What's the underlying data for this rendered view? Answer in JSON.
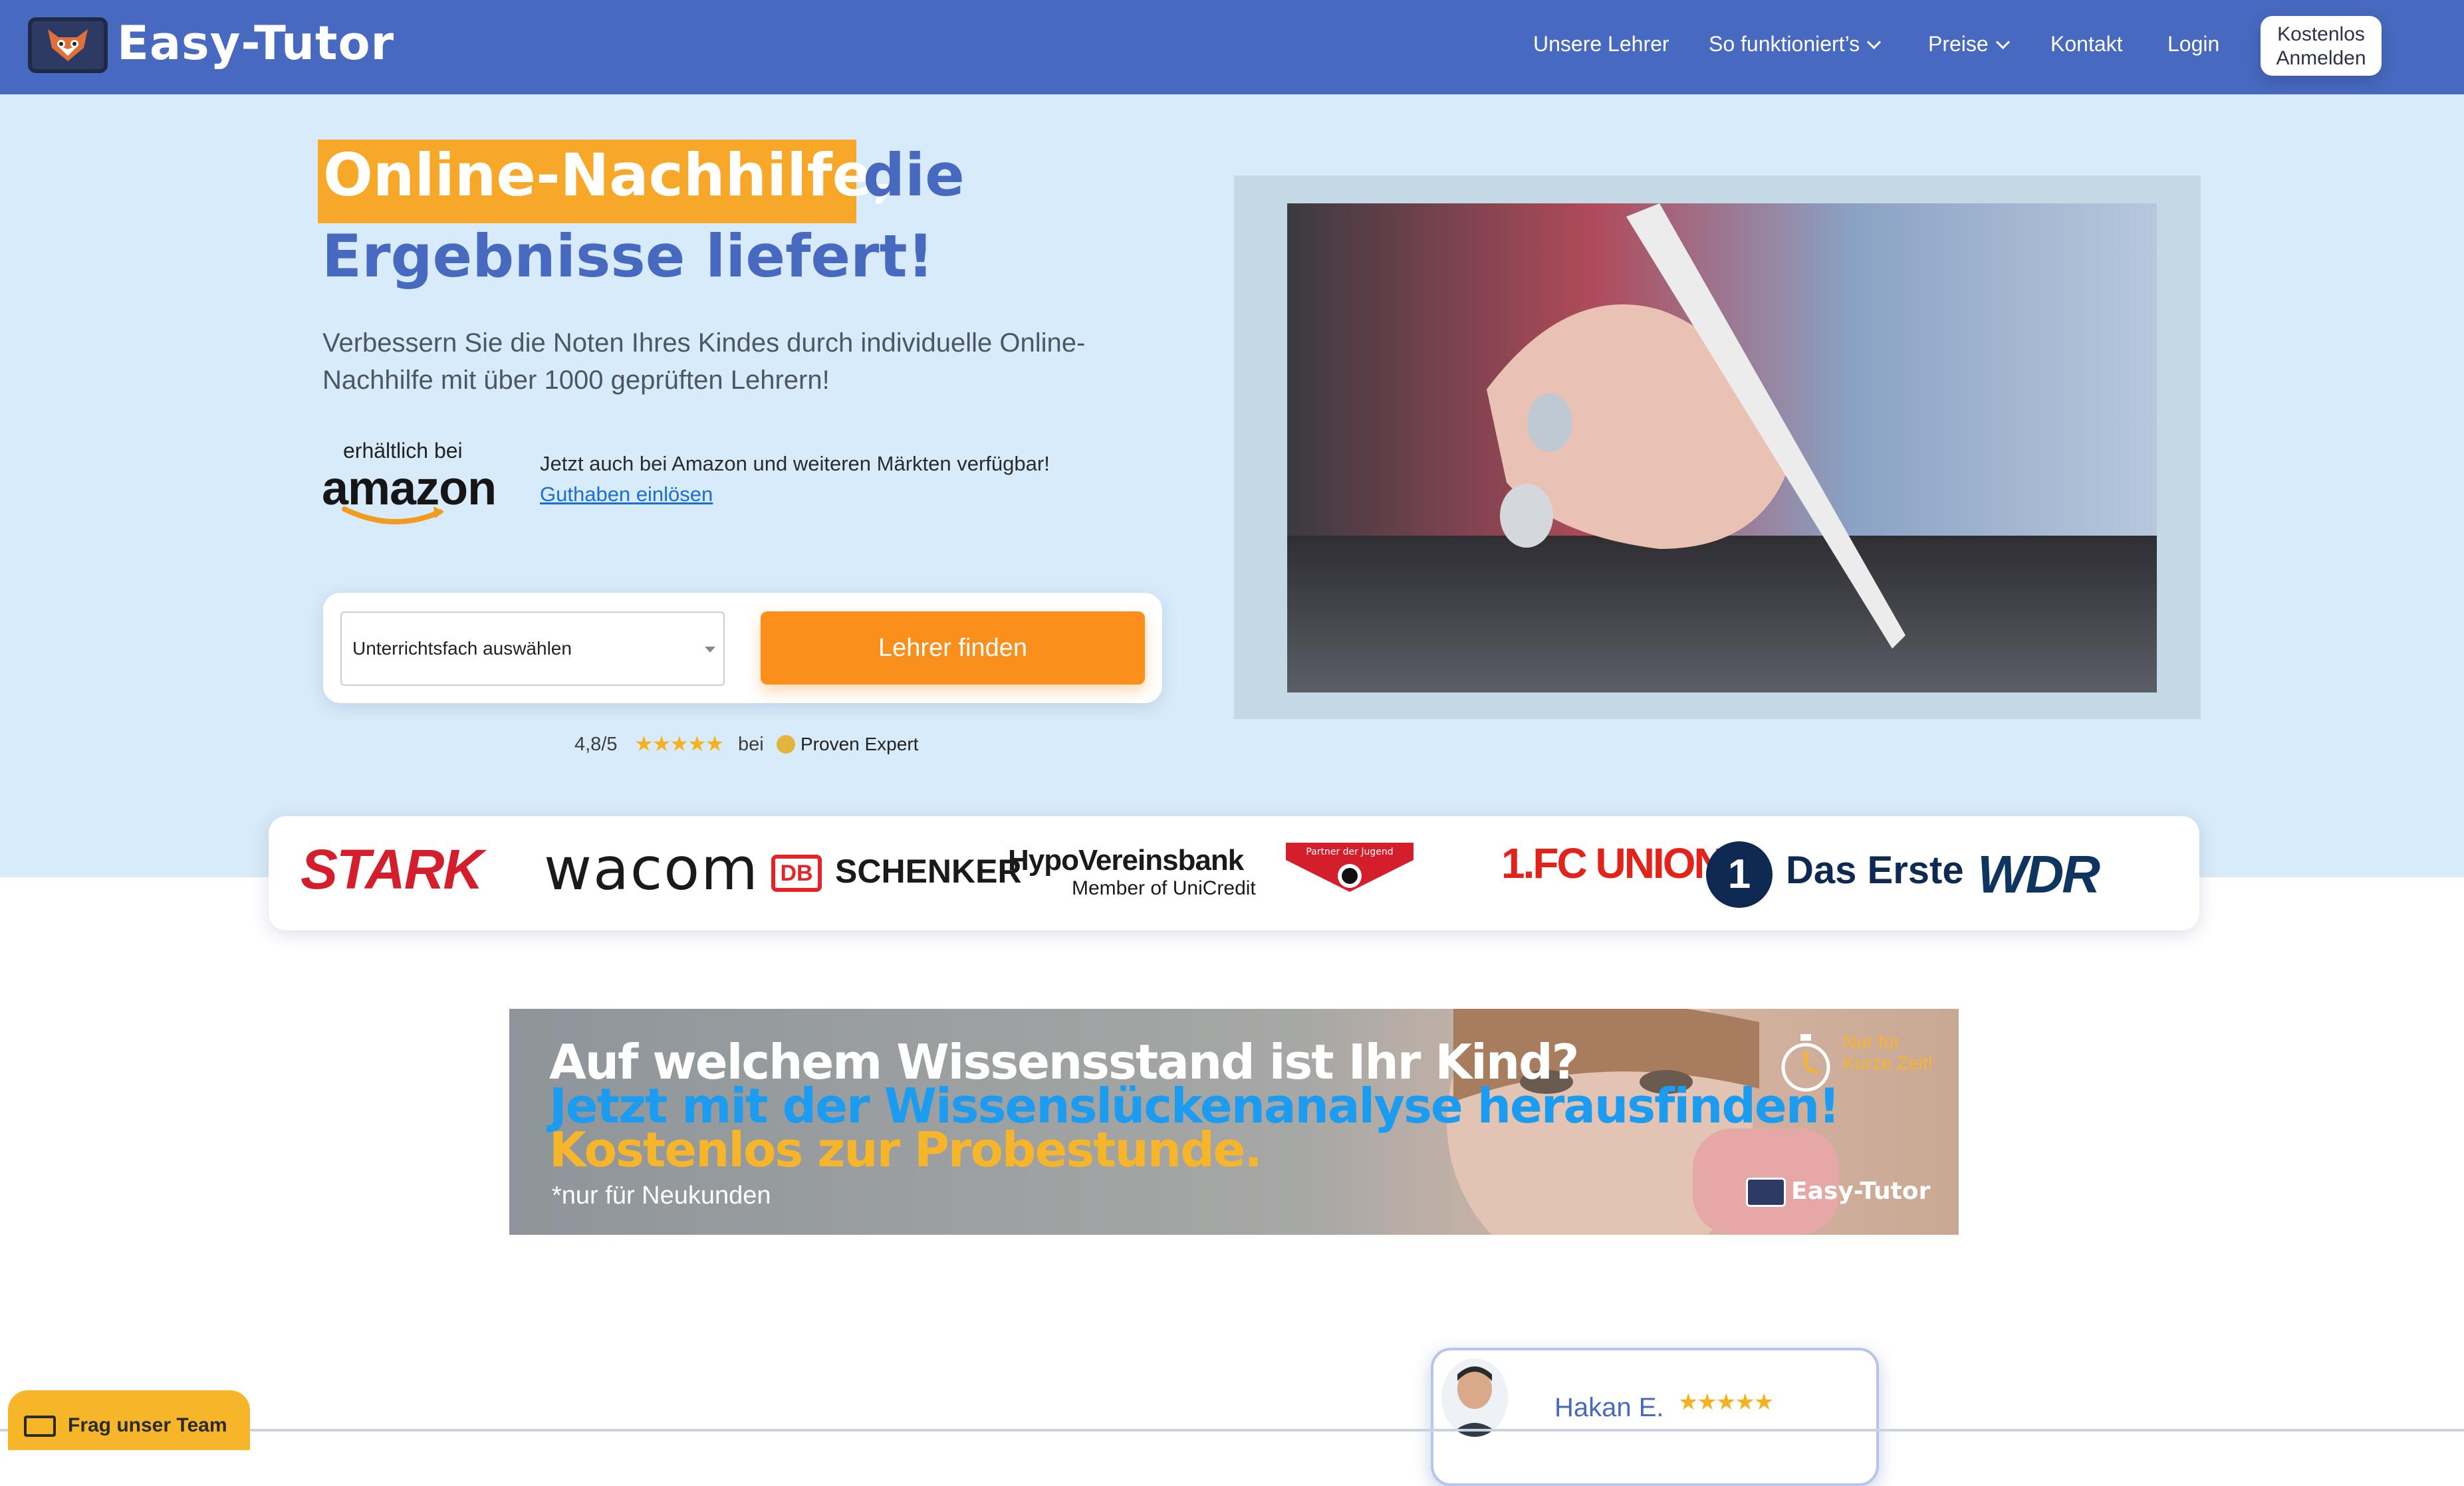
{
  "brand": {
    "name": "Easy-Tutor"
  },
  "nav": {
    "items": [
      {
        "label": "Unsere Lehrer"
      },
      {
        "label": "So funktioniert’s"
      },
      {
        "label": "Preise"
      },
      {
        "label": "Kontakt"
      },
      {
        "label": "Login"
      }
    ],
    "signup": {
      "line1": "Kostenlos",
      "line2": "Anmelden"
    }
  },
  "hero": {
    "headline_highlight": "Online-Nachhilfe,",
    "headline_rest": "die",
    "headline_line2": "Ergebnisse liefert!",
    "subtitle": "Verbessern Sie die Noten Ihres Kindes durch individuelle Online-Nachhilfe mit über 1000 geprüften Lehrern!",
    "amazon": {
      "badge_small": "erhältlich bei",
      "badge_big": "amazon",
      "text": "Jetzt auch bei Amazon und weiteren Märkten verfügbar!",
      "link": "Guthaben einlösen"
    },
    "search": {
      "select_value": "Unterrichtsfach auswählen",
      "button": "Lehrer finden"
    },
    "rating": {
      "score": "4,8/5",
      "stars": "★★★★★",
      "bei": "bei",
      "provider": "Proven Expert"
    }
  },
  "partners": {
    "stark": "STARK",
    "wacom": "wacom",
    "db": "DB",
    "schenker": "SCHENKER",
    "hypo": "HypoVereinsbank",
    "unicredit": "Member of UniCredit",
    "bayer_text": "Partner der Jugend",
    "union": "1.FC UNION",
    "erste_num": "1",
    "erste": "Das Erste",
    "wdr": "WDR"
  },
  "banner": {
    "line1": "Auf welchem Wissensstand ist Ihr Kind?",
    "line2": "Jetzt mit der Wissenslückenanalyse herausfinden!",
    "line3": "Kostenlos zur Probestunde.",
    "note": "*nur für Neukunden",
    "limited": "Nur für Kurze Zeit!",
    "logo_text": "Easy-Tutor"
  },
  "teacher": {
    "name": "Hakan E.",
    "stars": "★★★★★"
  },
  "chat": {
    "label": "Frag unser Team"
  },
  "colors": {
    "nav_bg": "#4769bf",
    "hero_bg": "#d7ebfa",
    "accent_orange": "#fb8f1c",
    "highlight_yellow": "#f7a829"
  }
}
